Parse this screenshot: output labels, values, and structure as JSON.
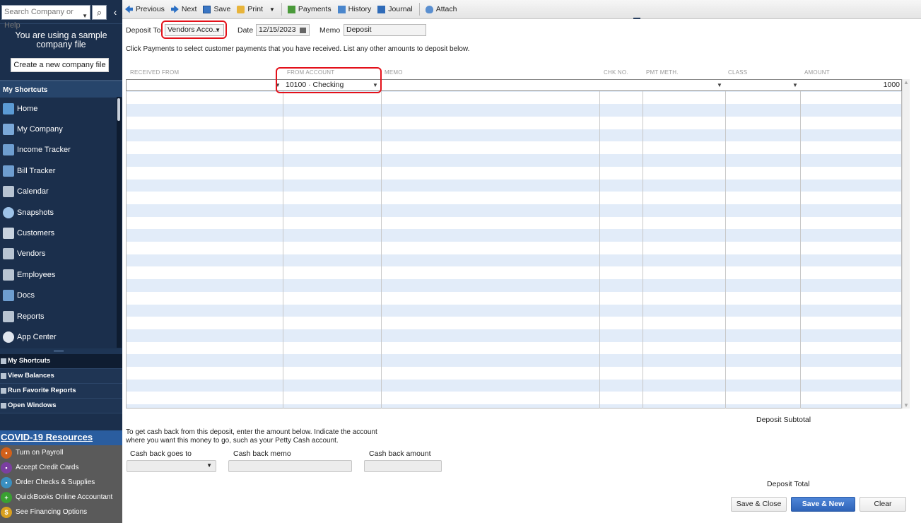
{
  "sidebar": {
    "search_placeholder": "Search Company or Help",
    "sample_message": "You are using a sample company file",
    "create_button": "Create a new company file",
    "shortcuts_header": "My Shortcuts",
    "nav_items": [
      {
        "label": "Home",
        "icon": "home-icon"
      },
      {
        "label": "My Company",
        "icon": "my-company-icon"
      },
      {
        "label": "Income Tracker",
        "icon": "income-tracker-icon"
      },
      {
        "label": "Bill Tracker",
        "icon": "bill-tracker-icon"
      },
      {
        "label": "Calendar",
        "icon": "calendar-icon"
      },
      {
        "label": "Snapshots",
        "icon": "snapshots-icon"
      },
      {
        "label": "Customers",
        "icon": "customers-icon"
      },
      {
        "label": "Vendors",
        "icon": "vendors-icon"
      },
      {
        "label": "Employees",
        "icon": "employees-icon"
      },
      {
        "label": "Docs",
        "icon": "docs-icon"
      },
      {
        "label": "Reports",
        "icon": "reports-icon"
      },
      {
        "label": "App Center",
        "icon": "app-center-icon"
      }
    ],
    "sections": [
      {
        "label": "My Shortcuts"
      },
      {
        "label": "View Balances"
      },
      {
        "label": "Run Favorite Reports"
      },
      {
        "label": "Open Windows"
      }
    ],
    "covid_link": "COVID-19 Resources",
    "promos": [
      {
        "label": "Turn on Payroll",
        "color": "#d2601a"
      },
      {
        "label": "Accept Credit Cards",
        "color": "#7b3fa0"
      },
      {
        "label": "Order Checks & Supplies",
        "color": "#3a8fc0"
      },
      {
        "label": "QuickBooks Online Accountant",
        "color": "#3aa032"
      },
      {
        "label": "See Financing Options",
        "color": "#d9a020"
      }
    ]
  },
  "toolbar": {
    "previous": "Previous",
    "next": "Next",
    "save": "Save",
    "print": "Print",
    "payments": "Payments",
    "history": "History",
    "journal": "Journal",
    "attach": "Attach"
  },
  "form": {
    "deposit_to_label": "Deposit To",
    "deposit_to_value": "Vendors Acco...",
    "date_label": "Date",
    "date_value": "12/15/2023",
    "memo_label": "Memo",
    "memo_value": "Deposit",
    "instructions": "Click Payments to select customer payments that you have received. List any other amounts to deposit below."
  },
  "grid": {
    "columns": [
      "RECEIVED FROM",
      "FROM ACCOUNT",
      "MEMO",
      "CHK NO.",
      "PMT METH.",
      "CLASS",
      "AMOUNT"
    ],
    "rows": [
      {
        "received_from": "",
        "from_account": "10100 · Checking",
        "memo": "",
        "chk_no": "",
        "pmt_meth": "",
        "class": "",
        "amount": "1000"
      }
    ]
  },
  "summary": {
    "subtotal_label": "Deposit Subtotal",
    "cashback_instructions_1": "To get cash back from this deposit, enter the amount below.  Indicate the account",
    "cashback_instructions_2": "where you want this money to go, such as your Petty Cash account.",
    "cashback_goes_to_label": "Cash back goes to",
    "cashback_memo_label": "Cash back memo",
    "cashback_amount_label": "Cash back amount",
    "total_label": "Deposit Total"
  },
  "buttons": {
    "save_close": "Save & Close",
    "save_new": "Save & New",
    "clear": "Clear"
  }
}
